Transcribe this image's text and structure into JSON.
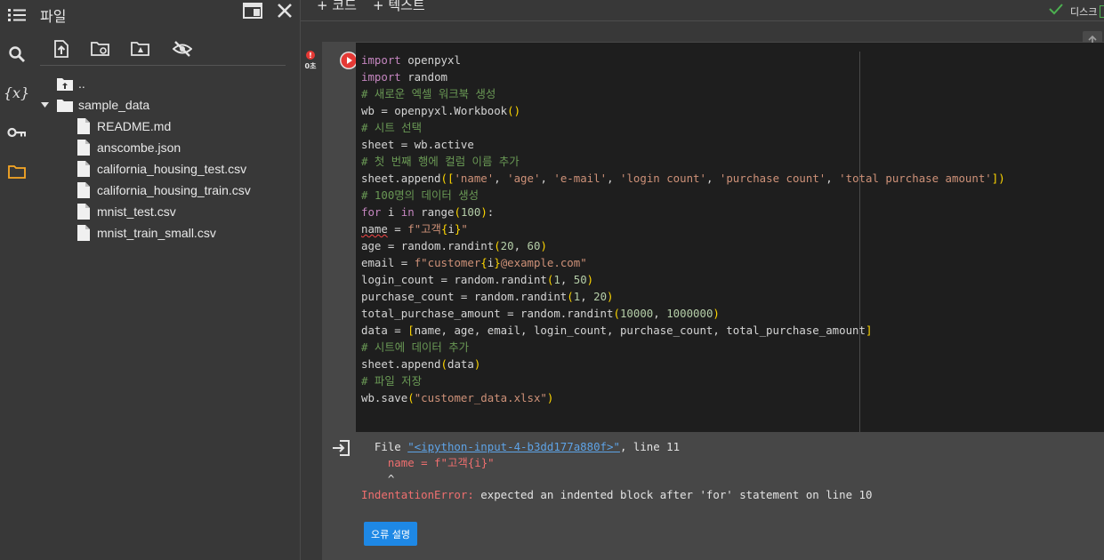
{
  "rail": {
    "icons": [
      "list-icon",
      "search-icon",
      "variables-icon",
      "key-icon",
      "folder-icon"
    ],
    "variables_label": "{x}",
    "active_color": "#f9a825"
  },
  "panel": {
    "title": "파일",
    "tools": [
      "upload-icon",
      "refresh-folder-icon",
      "drive-icon",
      "hide-icon"
    ],
    "tree": {
      "parent": "..",
      "folder": "sample_data",
      "files": [
        "README.md",
        "anscombe.json",
        "california_housing_test.csv",
        "california_housing_train.csv",
        "mnist_test.csv",
        "mnist_train_small.csv"
      ]
    }
  },
  "toolbar": {
    "add_code": "+ 코드",
    "add_text": "+ 텍스트",
    "disk_label": "디스크"
  },
  "cell": {
    "exec_time": "0초",
    "code_lines": [
      [
        [
          "kw",
          "import"
        ],
        [
          "ok",
          " openpyxl"
        ]
      ],
      [
        [
          "kw",
          "import"
        ],
        [
          "ok",
          " random"
        ]
      ],
      [
        [
          "cm",
          "# 새로운 엑셀 워크북 생성"
        ]
      ],
      [
        [
          "ok",
          "wb = openpyxl.Workbook"
        ],
        [
          "br",
          "()"
        ]
      ],
      [
        [
          "cm",
          "# 시트 선택"
        ]
      ],
      [
        [
          "ok",
          "sheet = wb.active"
        ]
      ],
      [
        [
          "cm",
          "# 첫 번째 행에 컬럼 이름 추가"
        ]
      ],
      [
        [
          "ok",
          "sheet.append"
        ],
        [
          "br",
          "(["
        ],
        [
          "st",
          "'name'"
        ],
        [
          "ok",
          ", "
        ],
        [
          "st",
          "'age'"
        ],
        [
          "ok",
          ", "
        ],
        [
          "st",
          "'e-mail'"
        ],
        [
          "ok",
          ", "
        ],
        [
          "st",
          "'login count'"
        ],
        [
          "ok",
          ", "
        ],
        [
          "st",
          "'purchase count'"
        ],
        [
          "ok",
          ", "
        ],
        [
          "st",
          "'total purchase amount'"
        ],
        [
          "br",
          "])"
        ]
      ],
      [
        [
          "cm",
          "# 100명의 데이터 생성"
        ]
      ],
      [
        [
          "kw",
          "for"
        ],
        [
          "ok",
          " i "
        ],
        [
          "kw",
          "in"
        ],
        [
          "ok",
          " range"
        ],
        [
          "br",
          "("
        ],
        [
          "nu",
          "100"
        ],
        [
          "br",
          ")"
        ],
        [
          "ok",
          ":"
        ]
      ],
      [
        [
          "sq",
          "name"
        ],
        [
          "ok",
          " = "
        ],
        [
          "st",
          "f\"고객"
        ],
        [
          "br",
          "{"
        ],
        [
          "ok",
          "i"
        ],
        [
          "br",
          "}"
        ],
        [
          "st",
          "\""
        ]
      ],
      [
        [
          "ok",
          "age = random.randint"
        ],
        [
          "br",
          "("
        ],
        [
          "nu",
          "20"
        ],
        [
          "ok",
          ", "
        ],
        [
          "nu",
          "60"
        ],
        [
          "br",
          ")"
        ]
      ],
      [
        [
          "ok",
          "email = "
        ],
        [
          "st",
          "f\"customer"
        ],
        [
          "br",
          "{"
        ],
        [
          "ok",
          "i"
        ],
        [
          "br",
          "}"
        ],
        [
          "st",
          "@example.com\""
        ]
      ],
      [
        [
          "ok",
          "login_count = random.randint"
        ],
        [
          "br",
          "("
        ],
        [
          "nu",
          "1"
        ],
        [
          "ok",
          ", "
        ],
        [
          "nu",
          "50"
        ],
        [
          "br",
          ")"
        ]
      ],
      [
        [
          "ok",
          "purchase_count = random.randint"
        ],
        [
          "br",
          "("
        ],
        [
          "nu",
          "1"
        ],
        [
          "ok",
          ", "
        ],
        [
          "nu",
          "20"
        ],
        [
          "br",
          ")"
        ]
      ],
      [
        [
          "ok",
          "total_purchase_amount = random.randint"
        ],
        [
          "br",
          "("
        ],
        [
          "nu",
          "10000"
        ],
        [
          "ok",
          ", "
        ],
        [
          "nu",
          "1000000"
        ],
        [
          "br",
          ")"
        ]
      ],
      [
        [
          "ok",
          "data = "
        ],
        [
          "br",
          "["
        ],
        [
          "ok",
          "name, age, email, login_count, purchase_count, total_purchase_amount"
        ],
        [
          "br",
          "]"
        ]
      ],
      [
        [
          "cm",
          "# 시트에 데이터 추가"
        ]
      ],
      [
        [
          "ok",
          "sheet.append"
        ],
        [
          "br",
          "("
        ],
        [
          "ok",
          "data"
        ],
        [
          "br",
          ")"
        ]
      ],
      [
        [
          "cm",
          "# 파일 저장"
        ]
      ],
      [
        [
          "ok",
          "wb.save"
        ],
        [
          "br",
          "("
        ],
        [
          "st",
          "\"customer_data.xlsx\""
        ],
        [
          "br",
          ")"
        ]
      ]
    ]
  },
  "output": {
    "file_prefix": "  File ",
    "file_link": "\"<ipython-input-4-b3dd177a880f>\"",
    "file_suffix": ", line 11",
    "code_line": "    name = f\"고객{i}\"",
    "caret_line": "    ^",
    "error_name": "IndentationError:",
    "error_msg": " expected an indented block after 'for' statement on line 10",
    "explain_button": "오류 설명"
  },
  "colors": {
    "background": "#383838",
    "editor_bg": "#1e1e1e",
    "cell_bg": "#474747",
    "keyword": "#c586c0",
    "comment": "#6a9955",
    "string": "#ce9178",
    "number": "#b5cea8",
    "bracket": "#ffd700",
    "error": "#ef6f6f",
    "link": "#5ea3e6",
    "button": "#1e88e5"
  }
}
